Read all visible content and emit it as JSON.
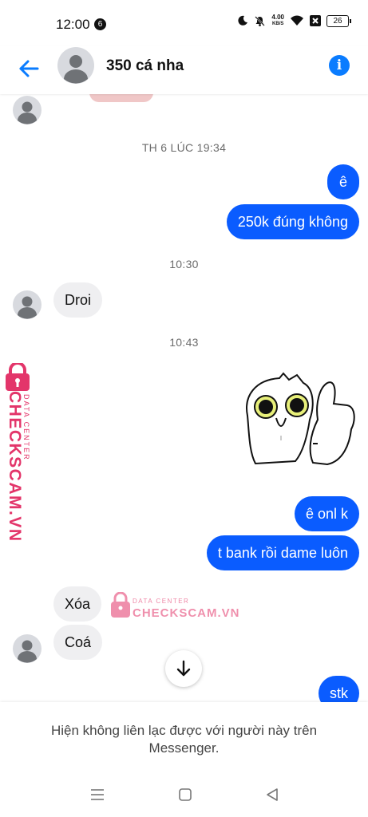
{
  "status_bar": {
    "time": "12:00",
    "notification_count": "6",
    "net_speed": "4.00",
    "net_unit": "KB/S",
    "battery": "26"
  },
  "header": {
    "title": "350 cá nha"
  },
  "messages": {
    "timestamp1": "TH 6 LÚC 19:34",
    "out1": "ê",
    "out2": "250k đúng không",
    "timestamp2": "10:30",
    "in1": "Droi",
    "timestamp3": "10:43",
    "out3": "ê onl k",
    "out4": "t bank rồi dame luôn",
    "in2": "Xóa",
    "in3": "Coá",
    "out5": "stk"
  },
  "watermark": {
    "main": "CHECKSCAM.VN",
    "sub": "DATA CENTER"
  },
  "footer": {
    "notice": "Hiện không liên lạc được với người này trên Messenger."
  },
  "colors": {
    "accent": "#0a7cff",
    "outgoing_bubble": "#0a5cff",
    "incoming_bubble": "#efeff1",
    "watermark": "#e3356a"
  }
}
